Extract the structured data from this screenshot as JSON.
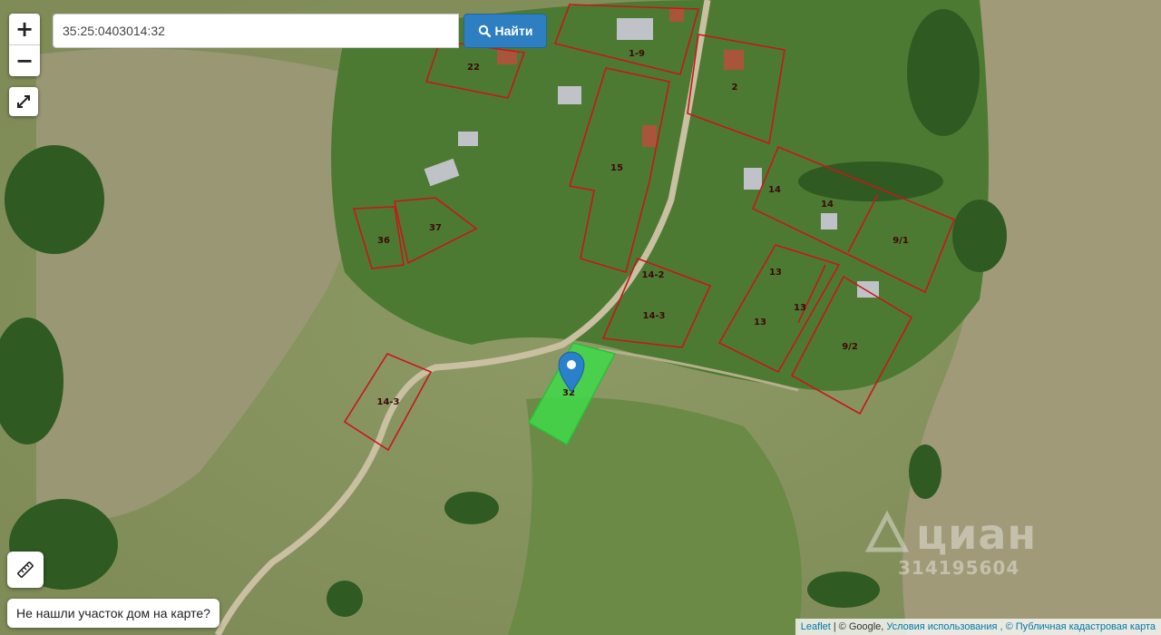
{
  "map": {
    "search": {
      "value": "35:25:0403014:32",
      "button_label": "Найти",
      "icon": "search-icon"
    },
    "zoom": {
      "in_label": "+",
      "out_label": "−"
    },
    "controls": {
      "fullscreen_icon": "expand-arrows-icon",
      "ruler_icon": "ruler-icon"
    },
    "not_found_label": "Не нашли участок дом на карте?",
    "attribution": {
      "leaflet": "Leaflet",
      "sep": "|",
      "google": "© Google,",
      "terms": "Условия использования",
      "rosreestr": ", © Публичная кадастровая карта"
    },
    "watermark": {
      "brand": "циан",
      "listing_id": "314195604"
    },
    "selected_plot_label": "32",
    "plot_labels": [
      "22",
      "1-9",
      "2",
      "15",
      "14",
      "14",
      "9/1",
      "36",
      "37",
      "14-2",
      "14-3",
      "13",
      "13",
      "13",
      "9/2",
      "14-3"
    ],
    "colors": {
      "plot_border": "#c6171b",
      "selected_fill": "#3fd94a",
      "marker": "#2a81cb",
      "search_button": "#2e7fc2"
    }
  }
}
